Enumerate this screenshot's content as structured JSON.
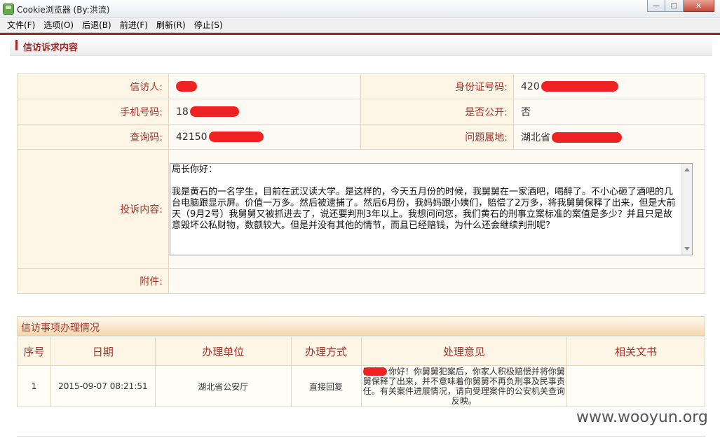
{
  "window": {
    "title": "Cookie浏览器 (By:洪流)"
  },
  "menu": [
    {
      "label": "文件(F)"
    },
    {
      "label": "选项(O)"
    },
    {
      "label": "后退(B)"
    },
    {
      "label": "前进(F)"
    },
    {
      "label": "刷新(R)"
    },
    {
      "label": "停止(S)"
    }
  ],
  "section1": {
    "title": "信访诉求内容"
  },
  "info": {
    "petitioner_label": "信访人:",
    "id_label": "身份证号码:",
    "id_value": "420",
    "phone_label": "手机号码:",
    "phone_value": "18",
    "public_label": "是否公开:",
    "public_value": "否",
    "query_label": "查询码:",
    "query_value": "42150",
    "location_label": "问题属地:",
    "location_value": "湖北省",
    "complaint_label": "投诉内容:",
    "complaint_text": "局长你好：\n\n我是黄石的一名学生，目前在武汉读大学。是这样的，今天五月份的时候，我舅舅在一家酒吧，喝醉了。不小心砸了酒吧的几台电脑跟显示屏。价值一万多。然后被逮捕了。然后6月份，我妈妈跟小姨们，赔偿了2万多，将我舅舅保释了出来，但是大前天（9月2号）我舅舅又被抓进去了，说还要判刑3年以上。我想问问您，我们黄石的刑事立案标准的案值是多少？并且只是故意毁坏公私财物，数额较大。但是并没有其他的情节，而且已经赔钱，为什么还会继续判刑呢？",
    "attachment_label": "附件:"
  },
  "section2": {
    "title": "信访事项办理情况"
  },
  "process": {
    "headers": [
      "序号",
      "日期",
      "办理单位",
      "办理方式",
      "处理意见",
      "相关文书"
    ],
    "rows": [
      {
        "no": "1",
        "date": "2015-09-07 08:21:51",
        "unit": "湖北省公安厅",
        "method": "直接回复",
        "opinion": "同学：你好！你舅舅犯案后，你家人积极赔偿并将你舅舅保释了出来，并不意味着你舅舅不再负刑事及民事责任。有关案件进展情况，请向受理案件的公安机关查询反映。",
        "docs": ""
      }
    ]
  },
  "watermark": "www.wooyun.org",
  "colors": {
    "accent": "#a4332c",
    "label_bg": "#fdf5e6",
    "redaction": "#ee2222"
  }
}
